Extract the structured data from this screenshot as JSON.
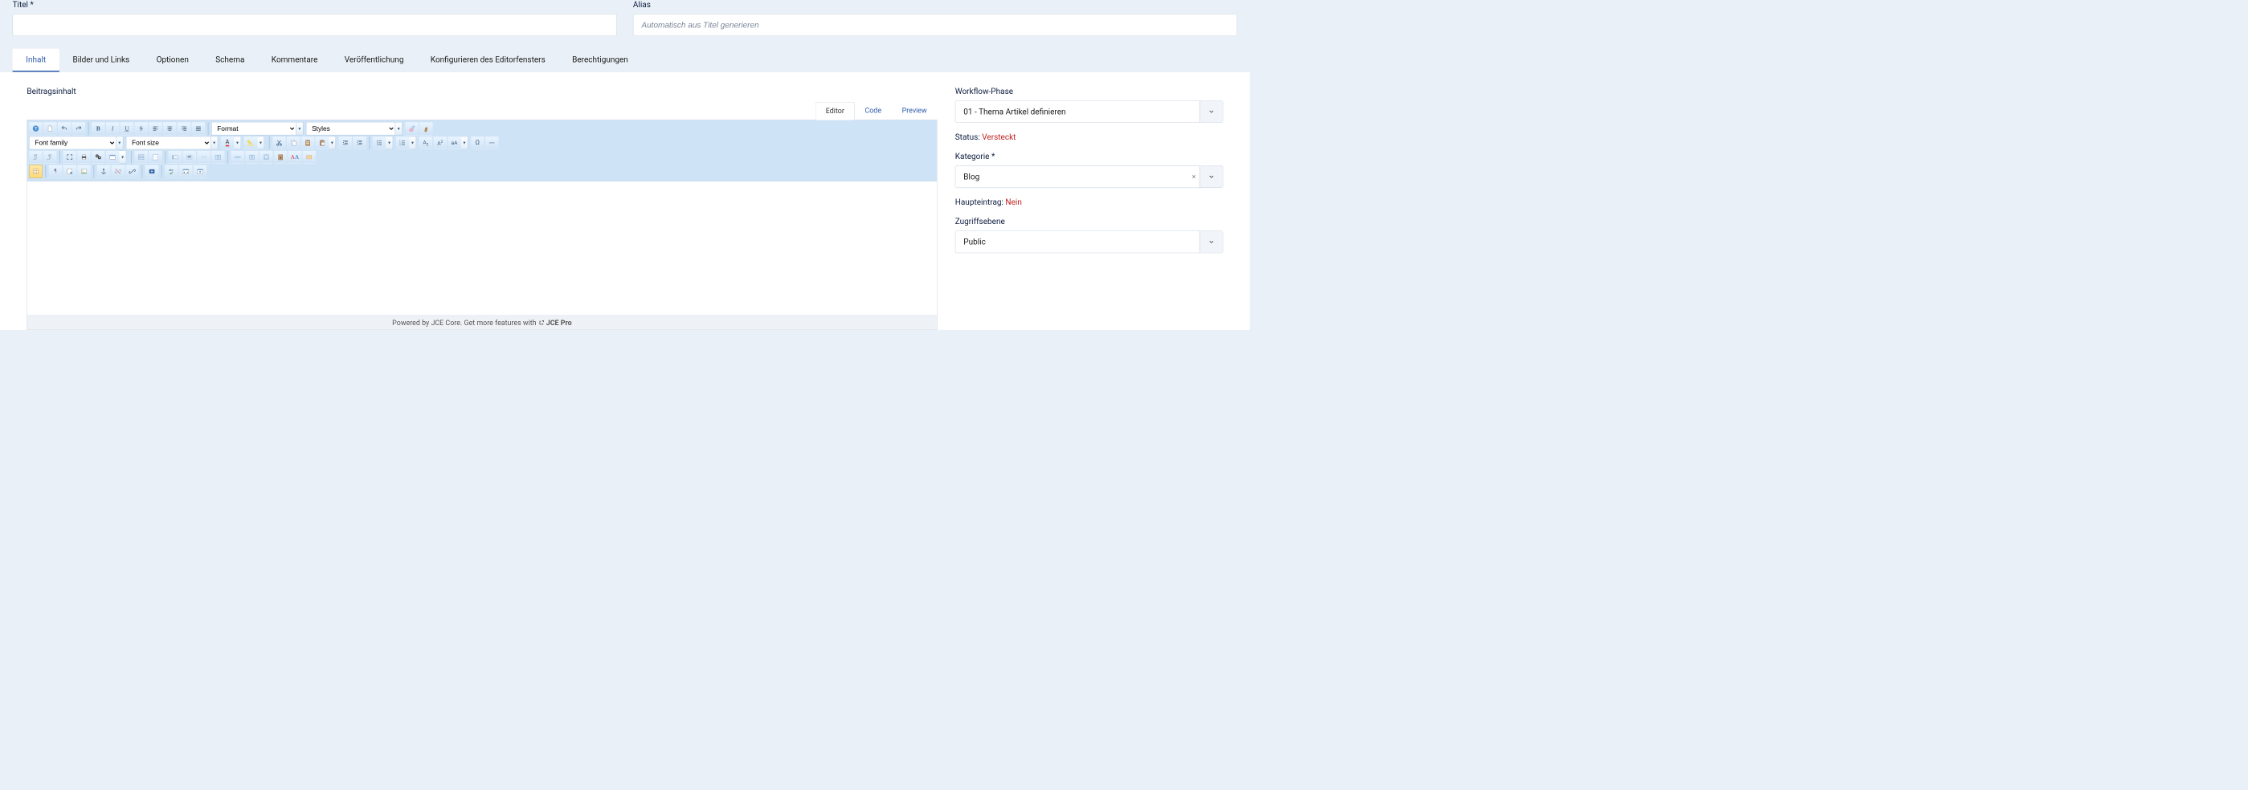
{
  "header": {
    "title_label": "Titel *",
    "title_value": "",
    "alias_label": "Alias",
    "alias_placeholder": "Automatisch aus Titel generieren",
    "alias_value": ""
  },
  "tabs": [
    {
      "label": "Inhalt",
      "active": true
    },
    {
      "label": "Bilder und Links"
    },
    {
      "label": "Optionen"
    },
    {
      "label": "Schema"
    },
    {
      "label": "Kommentare"
    },
    {
      "label": "Veröffentlichung"
    },
    {
      "label": "Konfigurieren des Editorfensters"
    },
    {
      "label": "Berechtigungen"
    }
  ],
  "editor": {
    "label": "Beitragsinhalt",
    "view_tabs": [
      {
        "label": "Editor",
        "active": true
      },
      {
        "label": "Code"
      },
      {
        "label": "Preview"
      }
    ],
    "format_placeholder": "Format",
    "styles_placeholder": "Styles",
    "family_placeholder": "Font family",
    "size_placeholder": "Font size",
    "footer_prefix": "Powered by JCE Core. Get more features with ",
    "footer_link": "JCE Pro"
  },
  "sidebar": {
    "workflow_label": "Workflow-Phase",
    "workflow_value": "01 - Thema Artikel definieren",
    "status_label": "Status:",
    "status_value": "Versteckt",
    "category_label": "Kategorie *",
    "category_value": "Blog",
    "featured_label": "Haupteintrag:",
    "featured_value": "Nein",
    "access_label": "Zugriffsebene",
    "access_value": "Public"
  }
}
